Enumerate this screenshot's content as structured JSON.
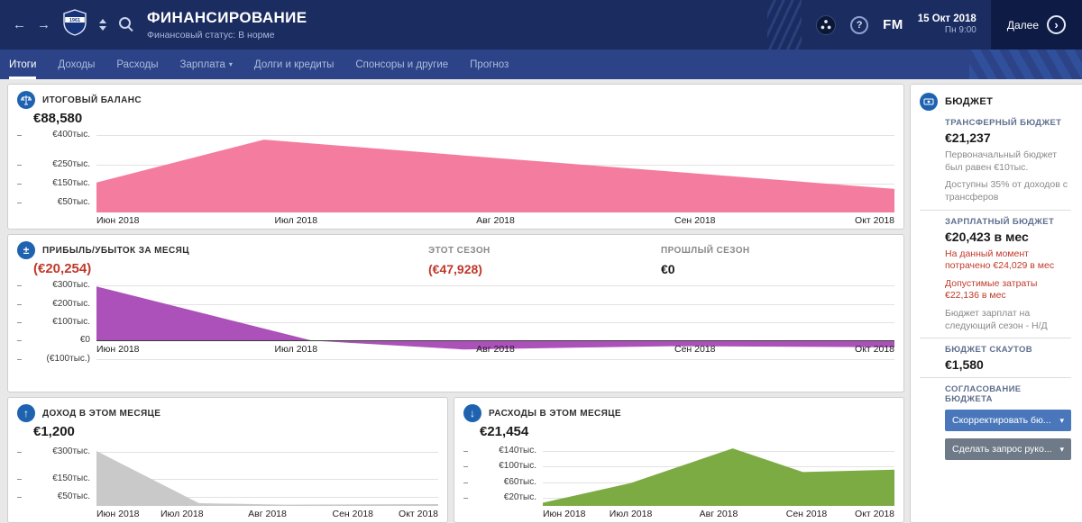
{
  "colors": {
    "header_bg": "#1b2c60",
    "tabs_bg": "#2c4487",
    "accent_blue": "#1f63b0",
    "negative_red": "#c0392b",
    "balance_pink": "#f47c9e",
    "profit_purple": "#ab51b9",
    "income_gray": "#c9c9c9",
    "expense_green": "#7cab43",
    "button_blue": "#4a77bb",
    "button_gray": "#6e7a88"
  },
  "icons": {
    "back": "←",
    "forward": "→",
    "help": "?",
    "chevron_down": "▾",
    "continue_arrow": "›",
    "balance": "⚖",
    "plus_minus": "±",
    "up_arrow": "↑",
    "down_arrow": "↓",
    "budget": "€"
  },
  "header": {
    "title": "ФИНАНСИРОВАНИЕ",
    "subtitle": "Финансовый статус: В норме",
    "fm_logo": "FM",
    "date": "15 Окт 2018",
    "time": "Пн 9:00",
    "continue_label": "Далее",
    "badge_year": "1961"
  },
  "tabs": [
    {
      "label": "Итоги",
      "active": true
    },
    {
      "label": "Доходы",
      "active": false
    },
    {
      "label": "Расходы",
      "active": false
    },
    {
      "label": "Зарплата",
      "active": false,
      "dropdown": true
    },
    {
      "label": "Долги и кредиты",
      "active": false
    },
    {
      "label": "Спонсоры и другие",
      "active": false
    },
    {
      "label": "Прогноз",
      "active": false
    }
  ],
  "cards": {
    "balance": {
      "title": "ИТОГОВЫЙ БАЛАНС",
      "value": "€88,580"
    },
    "profit": {
      "title": "ПРИБЫЛЬ/УБЫТОК ЗА МЕСЯЦ",
      "value": "(€20,254)",
      "this_season_label": "ЭТОТ СЕЗОН",
      "this_season_value": "(€47,928)",
      "last_season_label": "ПРОШЛЫЙ СЕЗОН",
      "last_season_value": "€0"
    },
    "income": {
      "title": "ДОХОД В ЭТОМ МЕСЯЦЕ",
      "value": "€1,200"
    },
    "expenses": {
      "title": "РАСХОДЫ В ЭТОМ МЕСЯЦЕ",
      "value": "€21,454"
    }
  },
  "sidebar": {
    "title": "БЮДЖЕТ",
    "transfer_label": "ТРАНСФЕРНЫЙ БЮДЖЕТ",
    "transfer_value": "€21,237",
    "transfer_note1": "Первоначальный бюджет был равен €10тыс.",
    "transfer_note2": "Доступны 35% от доходов с трансферов",
    "wage_label": "ЗАРПЛАТНЫЙ БЮДЖЕТ",
    "wage_value": "€20,423 в мес",
    "wage_spent": "На данный момент потрачено €24,029 в мес",
    "wage_allowed": "Допустимые затраты €22,136 в мес",
    "wage_next_season": "Бюджет зарплат на следующий сезон - Н/Д",
    "scout_label": "БЮДЖЕТ СКАУТОВ",
    "scout_value": "€1,580",
    "approval_label": "СОГЛАСОВАНИЕ БЮДЖЕТА",
    "adjust_button": "Скорректировать бю...",
    "request_button": "Сделать запрос руко..."
  },
  "chart_data": [
    {
      "type": "area",
      "title": "ИТОГОВЫЙ БАЛАНС",
      "color": "#f47c9e",
      "unit": "€ тыс.",
      "ylim": [
        0,
        430
      ],
      "yticks": [
        {
          "label": "€400тыс.",
          "value": 400
        },
        {
          "label": "€250тыс.",
          "value": 250
        },
        {
          "label": "€150тыс.",
          "value": 150
        },
        {
          "label": "€50тыс.",
          "value": 50
        }
      ],
      "x_labels": [
        "Июн 2018",
        "Июл 2018",
        "Авг 2018",
        "Сен 2018",
        "Окт 2018"
      ],
      "points": [
        [
          0,
          155
        ],
        [
          0.21,
          378
        ],
        [
          0.5,
          283
        ],
        [
          0.75,
          203
        ],
        [
          1,
          122
        ]
      ]
    },
    {
      "type": "area",
      "title": "ПРИБЫЛЬ/УБЫТОК ЗА МЕСЯЦ",
      "color": "#ab51b9",
      "unit": "€ тыс.",
      "ylim": [
        -130,
        330
      ],
      "zero_line": true,
      "labels_at_zero": true,
      "yticks": [
        {
          "label": "€300тыс.",
          "value": 300
        },
        {
          "label": "€200тыс.",
          "value": 200
        },
        {
          "label": "€100тыс.",
          "value": 100
        },
        {
          "label": "€0",
          "value": 0
        },
        {
          "label": "(€100тыс.)",
          "value": -100
        }
      ],
      "x_labels": [
        "Июн 2018",
        "Июл 2018",
        "Авг 2018",
        "Сен 2018",
        "Окт 2018"
      ],
      "points": [
        [
          0,
          295
        ],
        [
          0.27,
          0
        ],
        [
          0.46,
          -48
        ],
        [
          0.72,
          -30
        ],
        [
          1,
          -36
        ]
      ]
    },
    {
      "type": "area",
      "title": "ДОХОД В ЭТОМ МЕСЯЦЕ",
      "color": "#c9c9c9",
      "unit": "€ тыс.",
      "ylim": [
        0,
        350
      ],
      "yticks": [
        {
          "label": "€300тыс.",
          "value": 300
        },
        {
          "label": "€150тыс.",
          "value": 150
        },
        {
          "label": "€50тыс.",
          "value": 50
        }
      ],
      "x_labels": [
        "Июн 2018",
        "Июл 2018",
        "Авг 2018",
        "Сен 2018",
        "Окт 2018"
      ],
      "points": [
        [
          0,
          305
        ],
        [
          0.3,
          15
        ],
        [
          0.55,
          7
        ],
        [
          1,
          10
        ]
      ]
    },
    {
      "type": "area",
      "title": "РАСХОДЫ В ЭТОМ МЕСЯЦЕ",
      "color": "#7cab43",
      "unit": "€ тыс.",
      "ylim": [
        0,
        160
      ],
      "yticks": [
        {
          "label": "€140тыс.",
          "value": 140
        },
        {
          "label": "€100тыс.",
          "value": 100
        },
        {
          "label": "€60тыс.",
          "value": 60
        },
        {
          "label": "€20тыс.",
          "value": 20
        }
      ],
      "x_labels": [
        "Июн 2018",
        "Июл 2018",
        "Авг 2018",
        "Сен 2018",
        "Окт 2018"
      ],
      "points": [
        [
          0,
          8
        ],
        [
          0.25,
          58
        ],
        [
          0.54,
          146
        ],
        [
          0.74,
          86
        ],
        [
          1,
          92
        ]
      ]
    }
  ]
}
